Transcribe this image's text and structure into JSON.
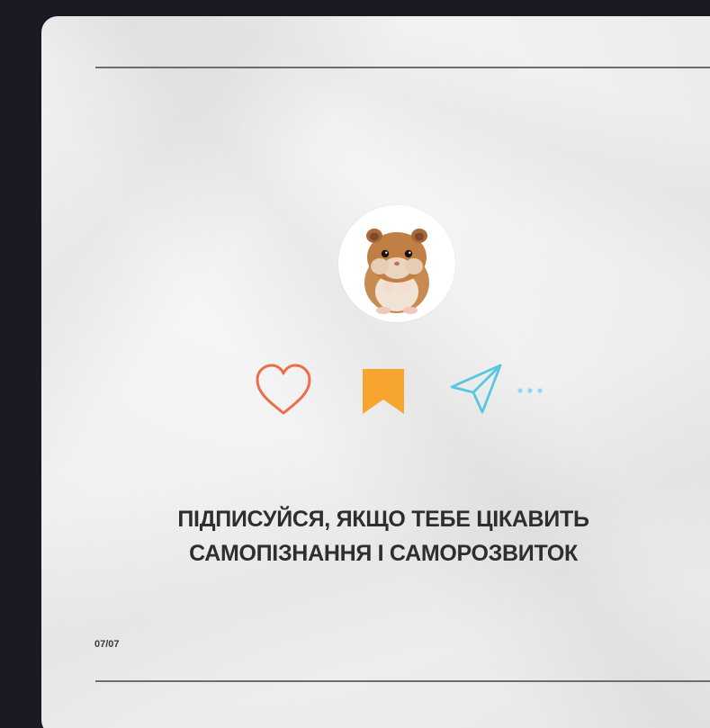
{
  "post": {
    "caption_line1": "ПІДПИСУЙСЯ, ЯКЩО ТЕБЕ ЦІКАВИТЬ",
    "caption_line2": "САМОПІЗНАННЯ І САМОРОЗВИТОК",
    "page_counter": "07/07"
  },
  "icons": {
    "avatar": "hamster-avatar",
    "like": "heart-icon",
    "save": "bookmark-icon",
    "share": "send-icon",
    "more": "ellipsis-icon"
  },
  "colors": {
    "background": "#1b1a22",
    "card": "#efefef",
    "heart": "#e8704a",
    "bookmark": "#f7a531",
    "send": "#57c7e2",
    "text": "#2e2e2e"
  }
}
